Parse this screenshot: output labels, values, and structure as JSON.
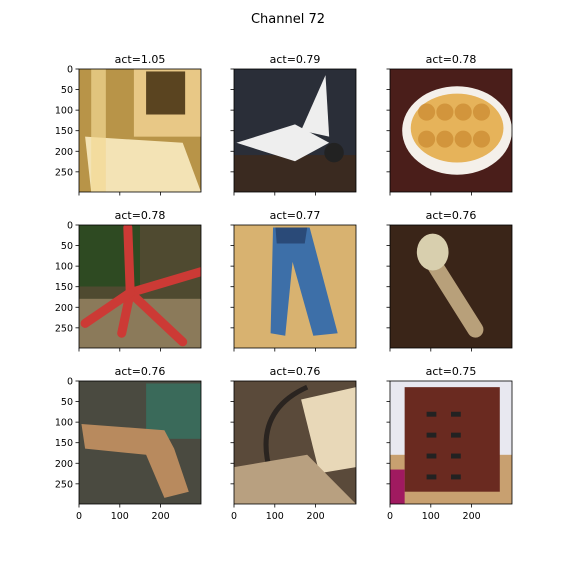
{
  "figure": {
    "title": "Channel 72"
  },
  "chart_data": {
    "type": "image_grid",
    "title": "Channel 72",
    "rows": 3,
    "cols": 3,
    "panels": [
      {
        "title": "act=1.05",
        "act": 1.05,
        "image": "bathroom-bathtub-photo",
        "colors": {
          "bg": "#b89448",
          "a": "#e8c886",
          "b": "#f3e3b5",
          "c": "#5a4420"
        }
      },
      {
        "title": "act=0.79",
        "act": 0.79,
        "image": "space-shuttle-photo",
        "colors": {
          "bg": "#2a2e38",
          "a": "#eeeeee",
          "b": "#3a2a20",
          "c": "#5b6a7a"
        }
      },
      {
        "title": "act=0.78",
        "act": 0.78,
        "image": "casserole-dish-photo",
        "colors": {
          "bg": "#4a1e1a",
          "a": "#f4f0ea",
          "b": "#e6b35a",
          "c": "#c9892f"
        }
      },
      {
        "title": "act=0.78",
        "act": 0.78,
        "image": "red-starfish-photo",
        "colors": {
          "bg": "#4f4a30",
          "a": "#cc3a35",
          "b": "#2e4a22",
          "c": "#8b7a5a"
        }
      },
      {
        "title": "act=0.77",
        "act": 0.77,
        "image": "blue-jeans-photo",
        "colors": {
          "bg": "#d8b270",
          "a": "#3d6fa8",
          "b": "#5a8bc0",
          "c": "#2a4a78"
        }
      },
      {
        "title": "act=0.76",
        "act": 0.76,
        "image": "mushroom-photo",
        "colors": {
          "bg": "#3a2518",
          "a": "#d8cfae",
          "b": "#b8a07a",
          "c": "#5a3a22"
        }
      },
      {
        "title": "act=0.76",
        "act": 0.76,
        "image": "wooden-object-workshop-photo",
        "colors": {
          "bg": "#4a4a40",
          "a": "#b88a5e",
          "b": "#3a6a5a",
          "c": "#7a6a50"
        }
      },
      {
        "title": "act=0.76",
        "act": 0.76,
        "image": "bow-on-shelf-photo",
        "colors": {
          "bg": "#5a4a3a",
          "a": "#e8d8b8",
          "b": "#2a2420",
          "c": "#b8a080"
        }
      },
      {
        "title": "act=0.75",
        "act": 0.75,
        "image": "wooden-cabinet-photo",
        "colors": {
          "bg": "#e8e8f0",
          "a": "#6a2a20",
          "b": "#c8a070",
          "c": "#a01a60"
        }
      }
    ],
    "y_ticks": [
      0,
      50,
      100,
      150,
      200,
      250
    ],
    "x_ticks": [
      0,
      100,
      200
    ],
    "xlim": [
      0,
      299
    ],
    "ylim": [
      299,
      0
    ],
    "grid": false
  }
}
